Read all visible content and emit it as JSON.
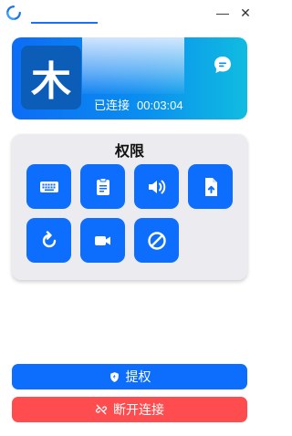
{
  "session": {
    "avatar_letter": "木",
    "status": "已连接",
    "duration": "00:03:04"
  },
  "window_controls": {
    "minimize": "—",
    "close": "✕"
  },
  "permissions": {
    "title": "权限",
    "items": [
      {
        "name": "keyboard",
        "icon": "keyboard-icon"
      },
      {
        "name": "clipboard",
        "icon": "clipboard-icon"
      },
      {
        "name": "audio",
        "icon": "speaker-icon"
      },
      {
        "name": "file-transfer",
        "icon": "file-upload-icon"
      },
      {
        "name": "restart",
        "icon": "restart-icon"
      },
      {
        "name": "recording",
        "icon": "video-camera-icon"
      },
      {
        "name": "block-input",
        "icon": "block-icon"
      }
    ]
  },
  "actions": {
    "elevate_label": "提权",
    "disconnect_label": "断开连接"
  },
  "colors": {
    "primary": "#0d6efd",
    "danger": "#ff4d4f",
    "panel": "#ececf0"
  }
}
